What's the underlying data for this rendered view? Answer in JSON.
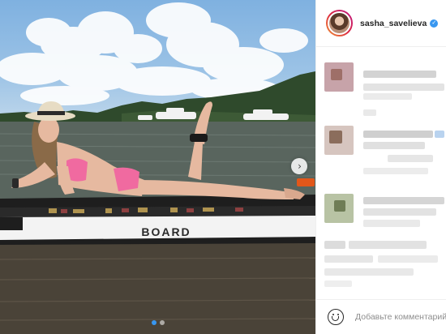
{
  "post": {
    "image_alt": "",
    "board_brand": "BOARD",
    "carousel": {
      "count": 2,
      "active_index": 0
    },
    "next_arrow_glyph": "›"
  },
  "header": {
    "username": "sasha_savelieva",
    "verified": true,
    "verified_glyph": "✓"
  },
  "comments": {
    "visible_count": 5,
    "content_blurred": true
  },
  "footer": {
    "emoji_icon": "smile-icon",
    "comment_placeholder": "Добавьте комментарий..."
  },
  "colors": {
    "accent_blue": "#3897f0",
    "divider": "#efefef",
    "placeholder_gray": "#8e8e8e",
    "swimsuit_pink": "#f06aa0"
  }
}
